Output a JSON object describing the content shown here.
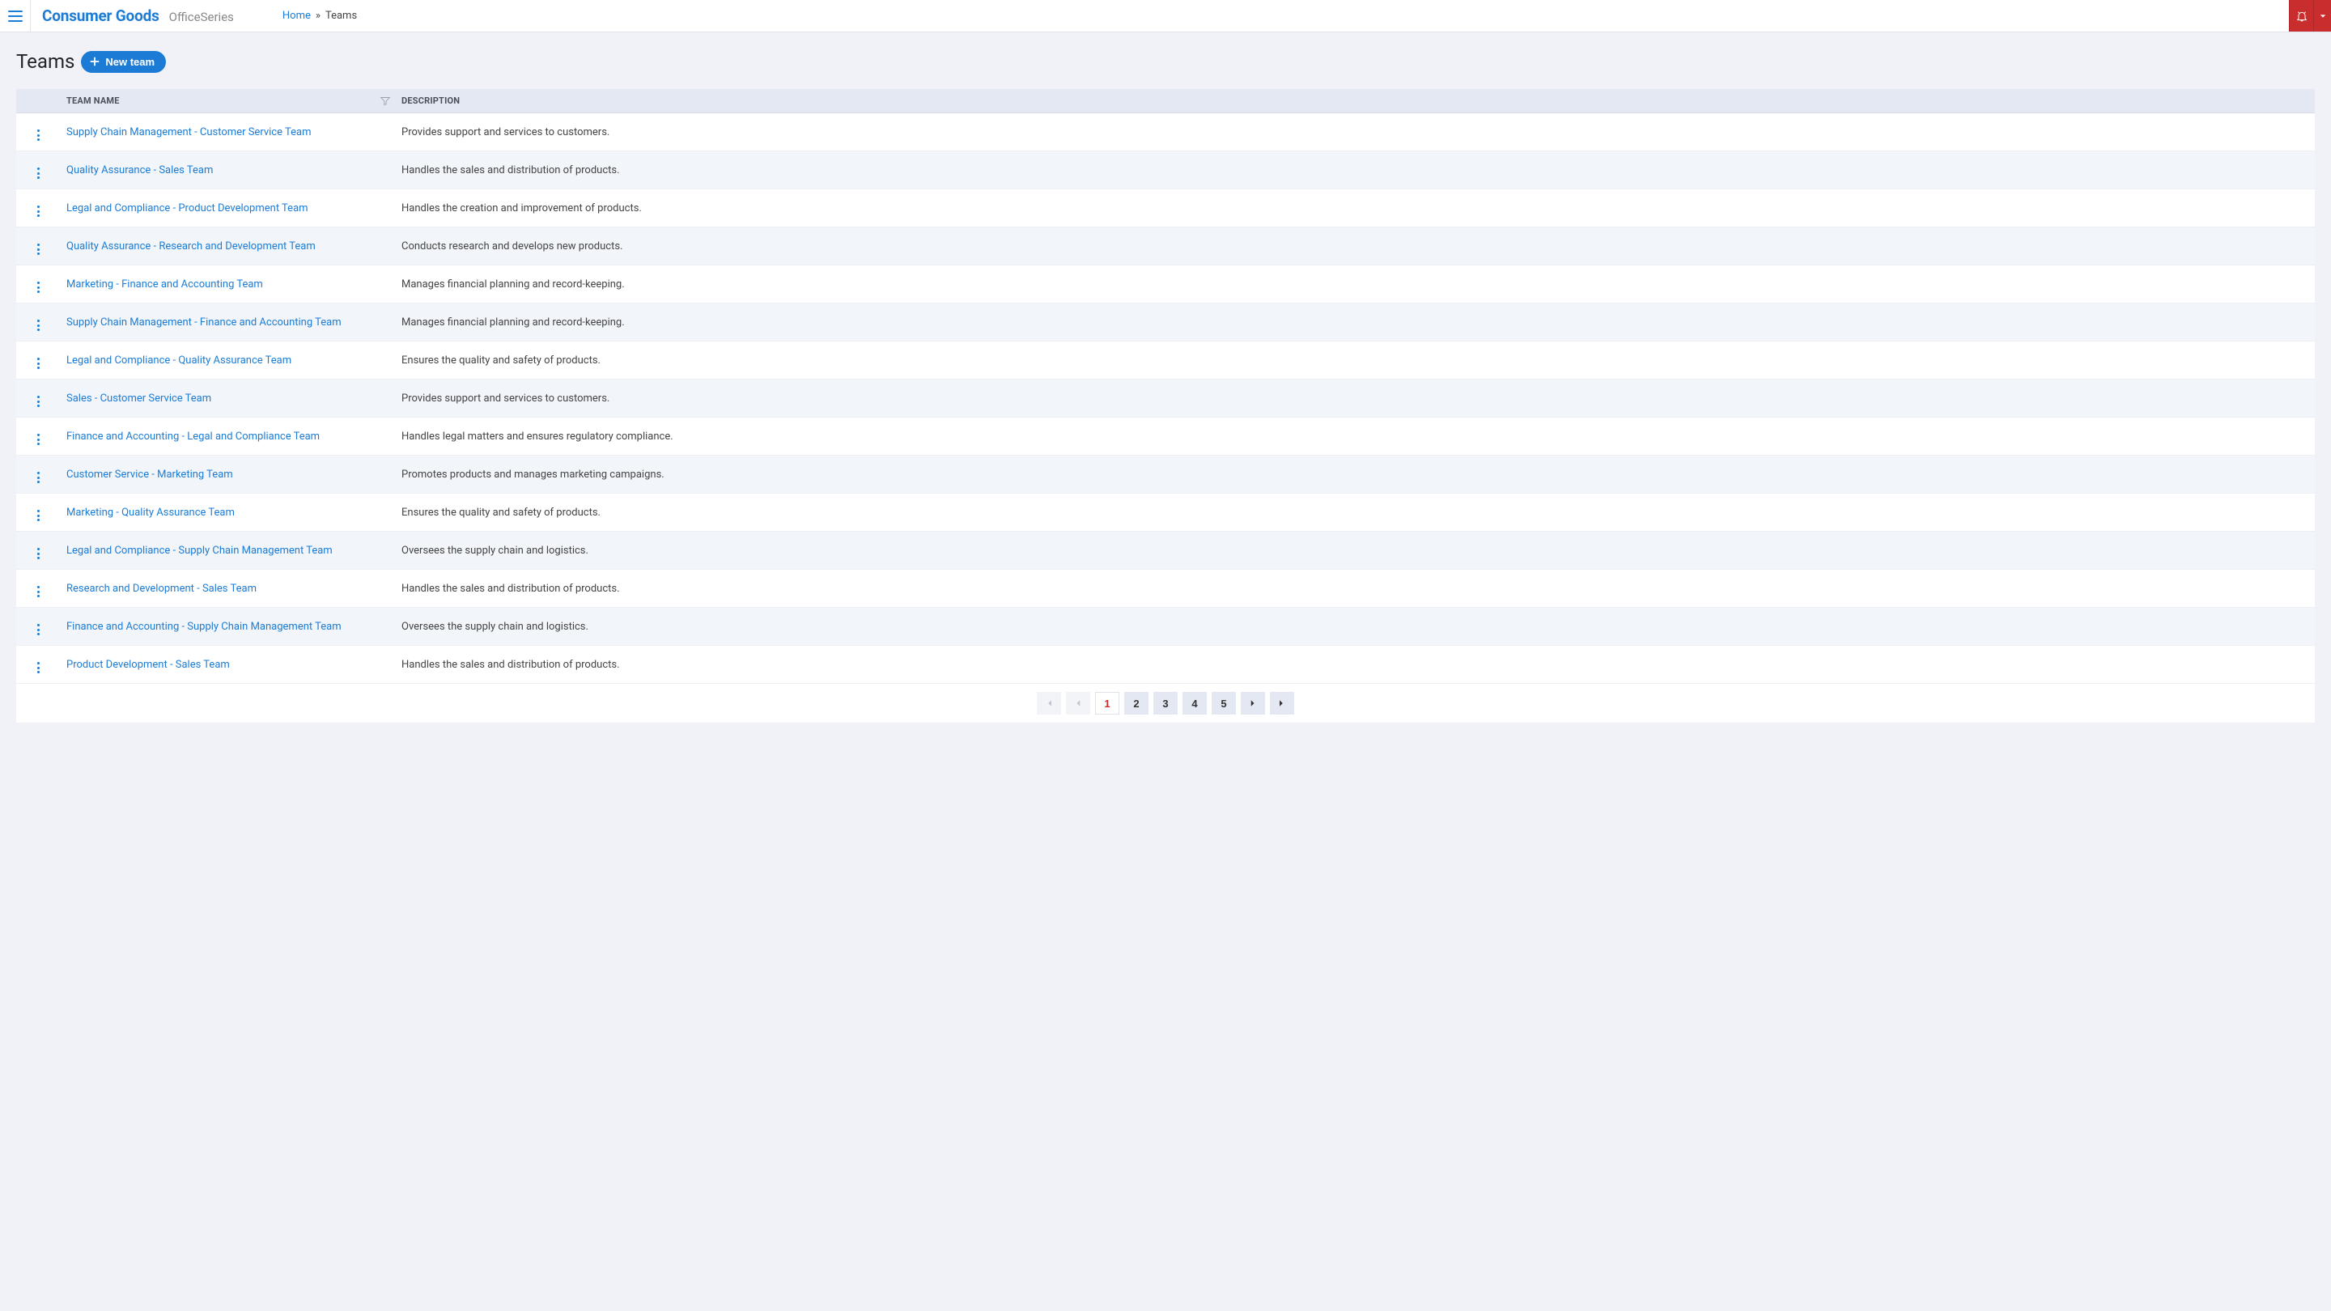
{
  "header": {
    "brand_primary": "Consumer Goods",
    "brand_secondary": "OfficeSeries"
  },
  "breadcrumb": {
    "home_label": "Home",
    "separator": "»",
    "current": "Teams"
  },
  "page": {
    "title": "Teams",
    "new_button_label": "New team"
  },
  "table": {
    "columns": {
      "name": "Team Name",
      "description": "Description"
    },
    "rows": [
      {
        "name": "Supply Chain Management - Customer Service Team",
        "description": "Provides support and services to customers."
      },
      {
        "name": "Quality Assurance - Sales Team",
        "description": "Handles the sales and distribution of products."
      },
      {
        "name": "Legal and Compliance - Product Development Team",
        "description": "Handles the creation and improvement of products."
      },
      {
        "name": "Quality Assurance - Research and Development Team",
        "description": "Conducts research and develops new products."
      },
      {
        "name": "Marketing - Finance and Accounting Team",
        "description": "Manages financial planning and record-keeping."
      },
      {
        "name": "Supply Chain Management - Finance and Accounting Team",
        "description": "Manages financial planning and record-keeping."
      },
      {
        "name": "Legal and Compliance - Quality Assurance Team",
        "description": "Ensures the quality and safety of products."
      },
      {
        "name": "Sales - Customer Service Team",
        "description": "Provides support and services to customers."
      },
      {
        "name": "Finance and Accounting - Legal and Compliance Team",
        "description": "Handles legal matters and ensures regulatory compliance."
      },
      {
        "name": "Customer Service - Marketing Team",
        "description": "Promotes products and manages marketing campaigns."
      },
      {
        "name": "Marketing - Quality Assurance Team",
        "description": "Ensures the quality and safety of products."
      },
      {
        "name": "Legal and Compliance - Supply Chain Management Team",
        "description": "Oversees the supply chain and logistics."
      },
      {
        "name": "Research and Development - Sales Team",
        "description": "Handles the sales and distribution of products."
      },
      {
        "name": "Finance and Accounting - Supply Chain Management Team",
        "description": "Oversees the supply chain and logistics."
      },
      {
        "name": "Product Development - Sales Team",
        "description": "Handles the sales and distribution of products."
      }
    ]
  },
  "pagination": {
    "pages": [
      "1",
      "2",
      "3",
      "4",
      "5"
    ],
    "current": "1"
  }
}
